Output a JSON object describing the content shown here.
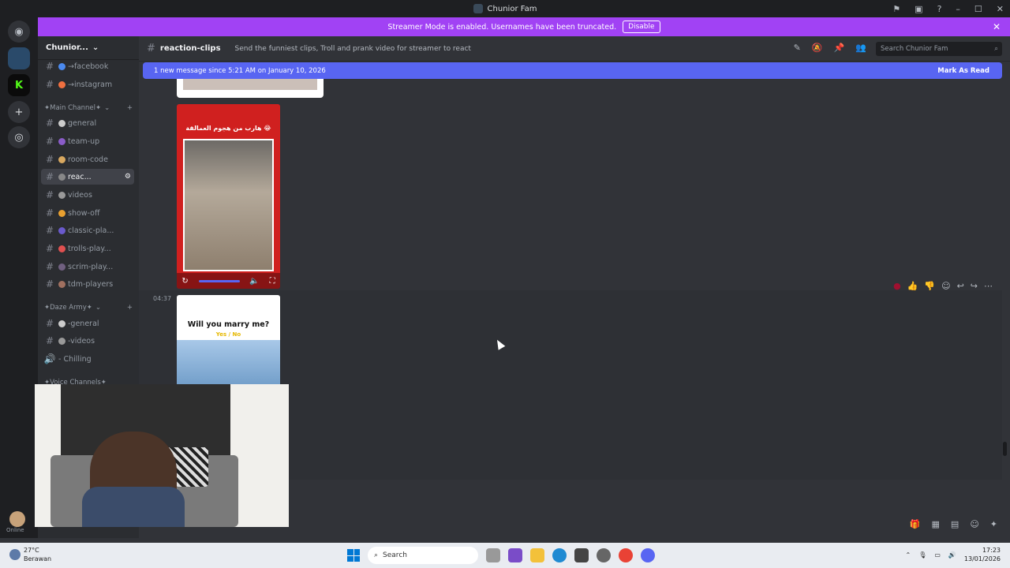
{
  "window": {
    "title": "Chunior Fam"
  },
  "banner": {
    "text": "Streamer Mode is enabled. Usernames have been truncated.",
    "disable_label": "Disable"
  },
  "sidebar": {
    "server_name": "Chunior...",
    "channels_top": [
      {
        "label": "→facebook"
      },
      {
        "label": "→instagram"
      }
    ],
    "categories": [
      {
        "label": "✦Main Channel✦",
        "channels": [
          "general",
          "team-up",
          "room-code",
          "reac...",
          "videos",
          "show-off",
          "classic-pla...",
          "trolls-play...",
          "scrim-play...",
          "tdm-players"
        ]
      },
      {
        "label": "✦Daze Army✦",
        "channels": [
          "-general",
          "-videos",
          "- Chilling"
        ]
      },
      {
        "label": "✦Voice Channels✦",
        "channels": []
      }
    ]
  },
  "channel": {
    "name": "reaction-clips",
    "topic": "Send the funniest clips, Troll and prank video for streamer to react",
    "search_placeholder": "Search Chunior Fam"
  },
  "new_message": {
    "text": "1 new message since 5:21 AM on January 10, 2026",
    "mark_read": "Mark As Read"
  },
  "messages": [
    {
      "caption": "هارب من هجوم العمالقة 😂"
    },
    {
      "timestamp": "04:37",
      "question": "Will you marry me?",
      "answers": "Yes / No"
    }
  ],
  "taskbar": {
    "temperature": "27°C",
    "condition": "Berawan",
    "search_label": "Search",
    "time": "17:23",
    "date": "13/01/2026"
  },
  "user": {
    "status": "Online"
  }
}
